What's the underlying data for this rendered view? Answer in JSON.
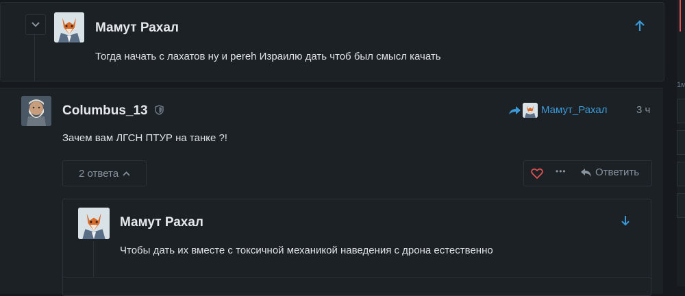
{
  "reply_top": {
    "author": "Мамут Рахал",
    "text": "Тогда начать с лахатов ну и pereh Израилю дать чтоб был смысл качать"
  },
  "comment": {
    "author": "Columbus_13",
    "reply_to": "Мамут_Рахал",
    "time": "3 ч",
    "text": "Зачем вам ЛГСН ПТУР на танке ?!",
    "replies_label": "2 ответа",
    "reply_label": "Ответить",
    "more_label": "•••"
  },
  "nested_reply": {
    "author": "Мамут Рахал",
    "text": "Чтобы дать их вместе с токсичной механикой наведения с дрона естественно"
  },
  "right_panel": {
    "partial_label": "1м"
  },
  "colors": {
    "accent": "#3a9ad9",
    "heart": "#e05252",
    "scrollbar_marker": "#e05252"
  },
  "icons": [
    "chevron-down-icon",
    "arrow-up-icon",
    "shield-icon",
    "share-reply-icon",
    "heart-icon",
    "more-icon",
    "reply-icon",
    "chevron-up-icon",
    "arrow-down-icon"
  ]
}
